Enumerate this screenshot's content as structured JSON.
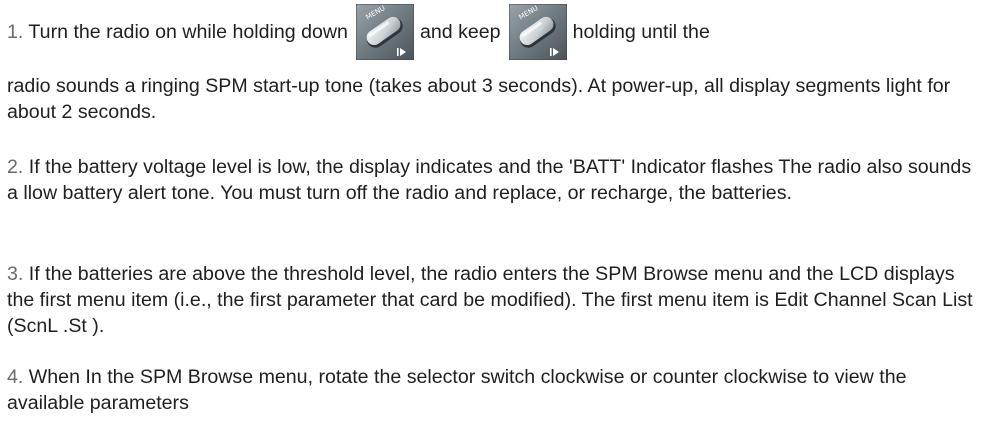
{
  "steps": [
    {
      "num": "1.",
      "part1": " Turn the radio on while holding down",
      "part2": "and keep",
      "part3": "holding until the",
      "continued": "radio sounds a ringing SPM start-up tone (takes about 3 seconds). At power-up, all display segments light for about 2 seconds.",
      "key_icon": "menu-button-icon"
    },
    {
      "num": "2.",
      "text": " If the battery voltage level is low, the display indicates and the 'BATT' Indicator flashes The radio also sounds a llow battery alert tone. You must turn off the radio and replace, or recharge, the batteries."
    },
    {
      "num": "3.",
      "text": " If the batteries are above the threshold level, the radio enters the SPM Browse menu and the LCD displays the first menu item (i.e., the first parameter that card be modified). The first menu item is Edit Channel Scan List (ScnL .St )."
    },
    {
      "num": "4.",
      "text": " When In the SPM Browse menu, rotate the selector switch clockwise or counter clockwise to view the available parameters"
    }
  ]
}
